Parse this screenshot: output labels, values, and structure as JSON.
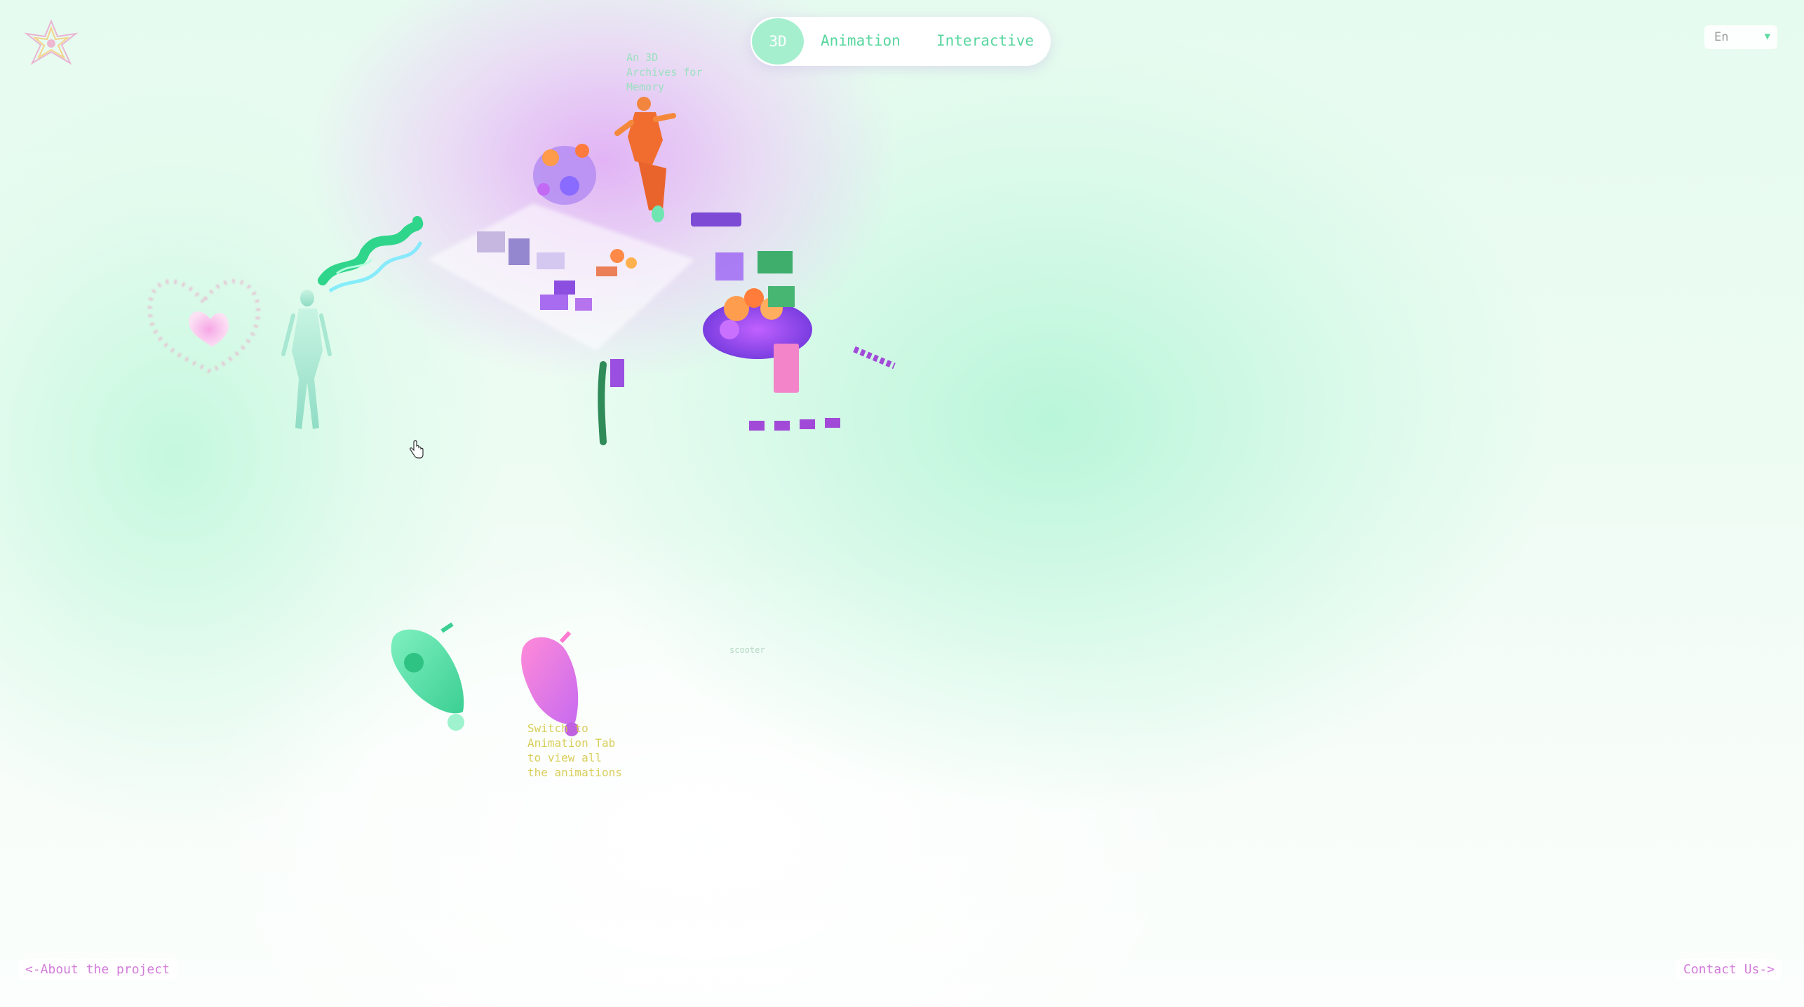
{
  "brand": {
    "logo": "star-logo-icon"
  },
  "nav": {
    "tabs": [
      {
        "label": "3D",
        "active": true
      },
      {
        "label": "Animation",
        "active": false
      },
      {
        "label": "Interactive",
        "active": false
      }
    ]
  },
  "language": {
    "selected": "En",
    "icon": "chevron-down-icon"
  },
  "scene": {
    "archive_label": "An 3D Archives for Memory",
    "hint": "Switch to Animation Tab to view all the animations",
    "small_label": "scooter",
    "objects": [
      "heart-frame",
      "woman-figure",
      "neon-graffiti-sign",
      "market-stall-cluster",
      "scooter-rider",
      "flower-cart",
      "green-scooter",
      "pink-scooter"
    ]
  },
  "footer": {
    "about": "<-About the project",
    "contact": "Contact Us->"
  },
  "colors": {
    "accent_green": "#57d69e",
    "active_tab_bg": "#a5efcf",
    "link_pink": "#d27bd9",
    "hint_yellow": "#d6c94a"
  }
}
